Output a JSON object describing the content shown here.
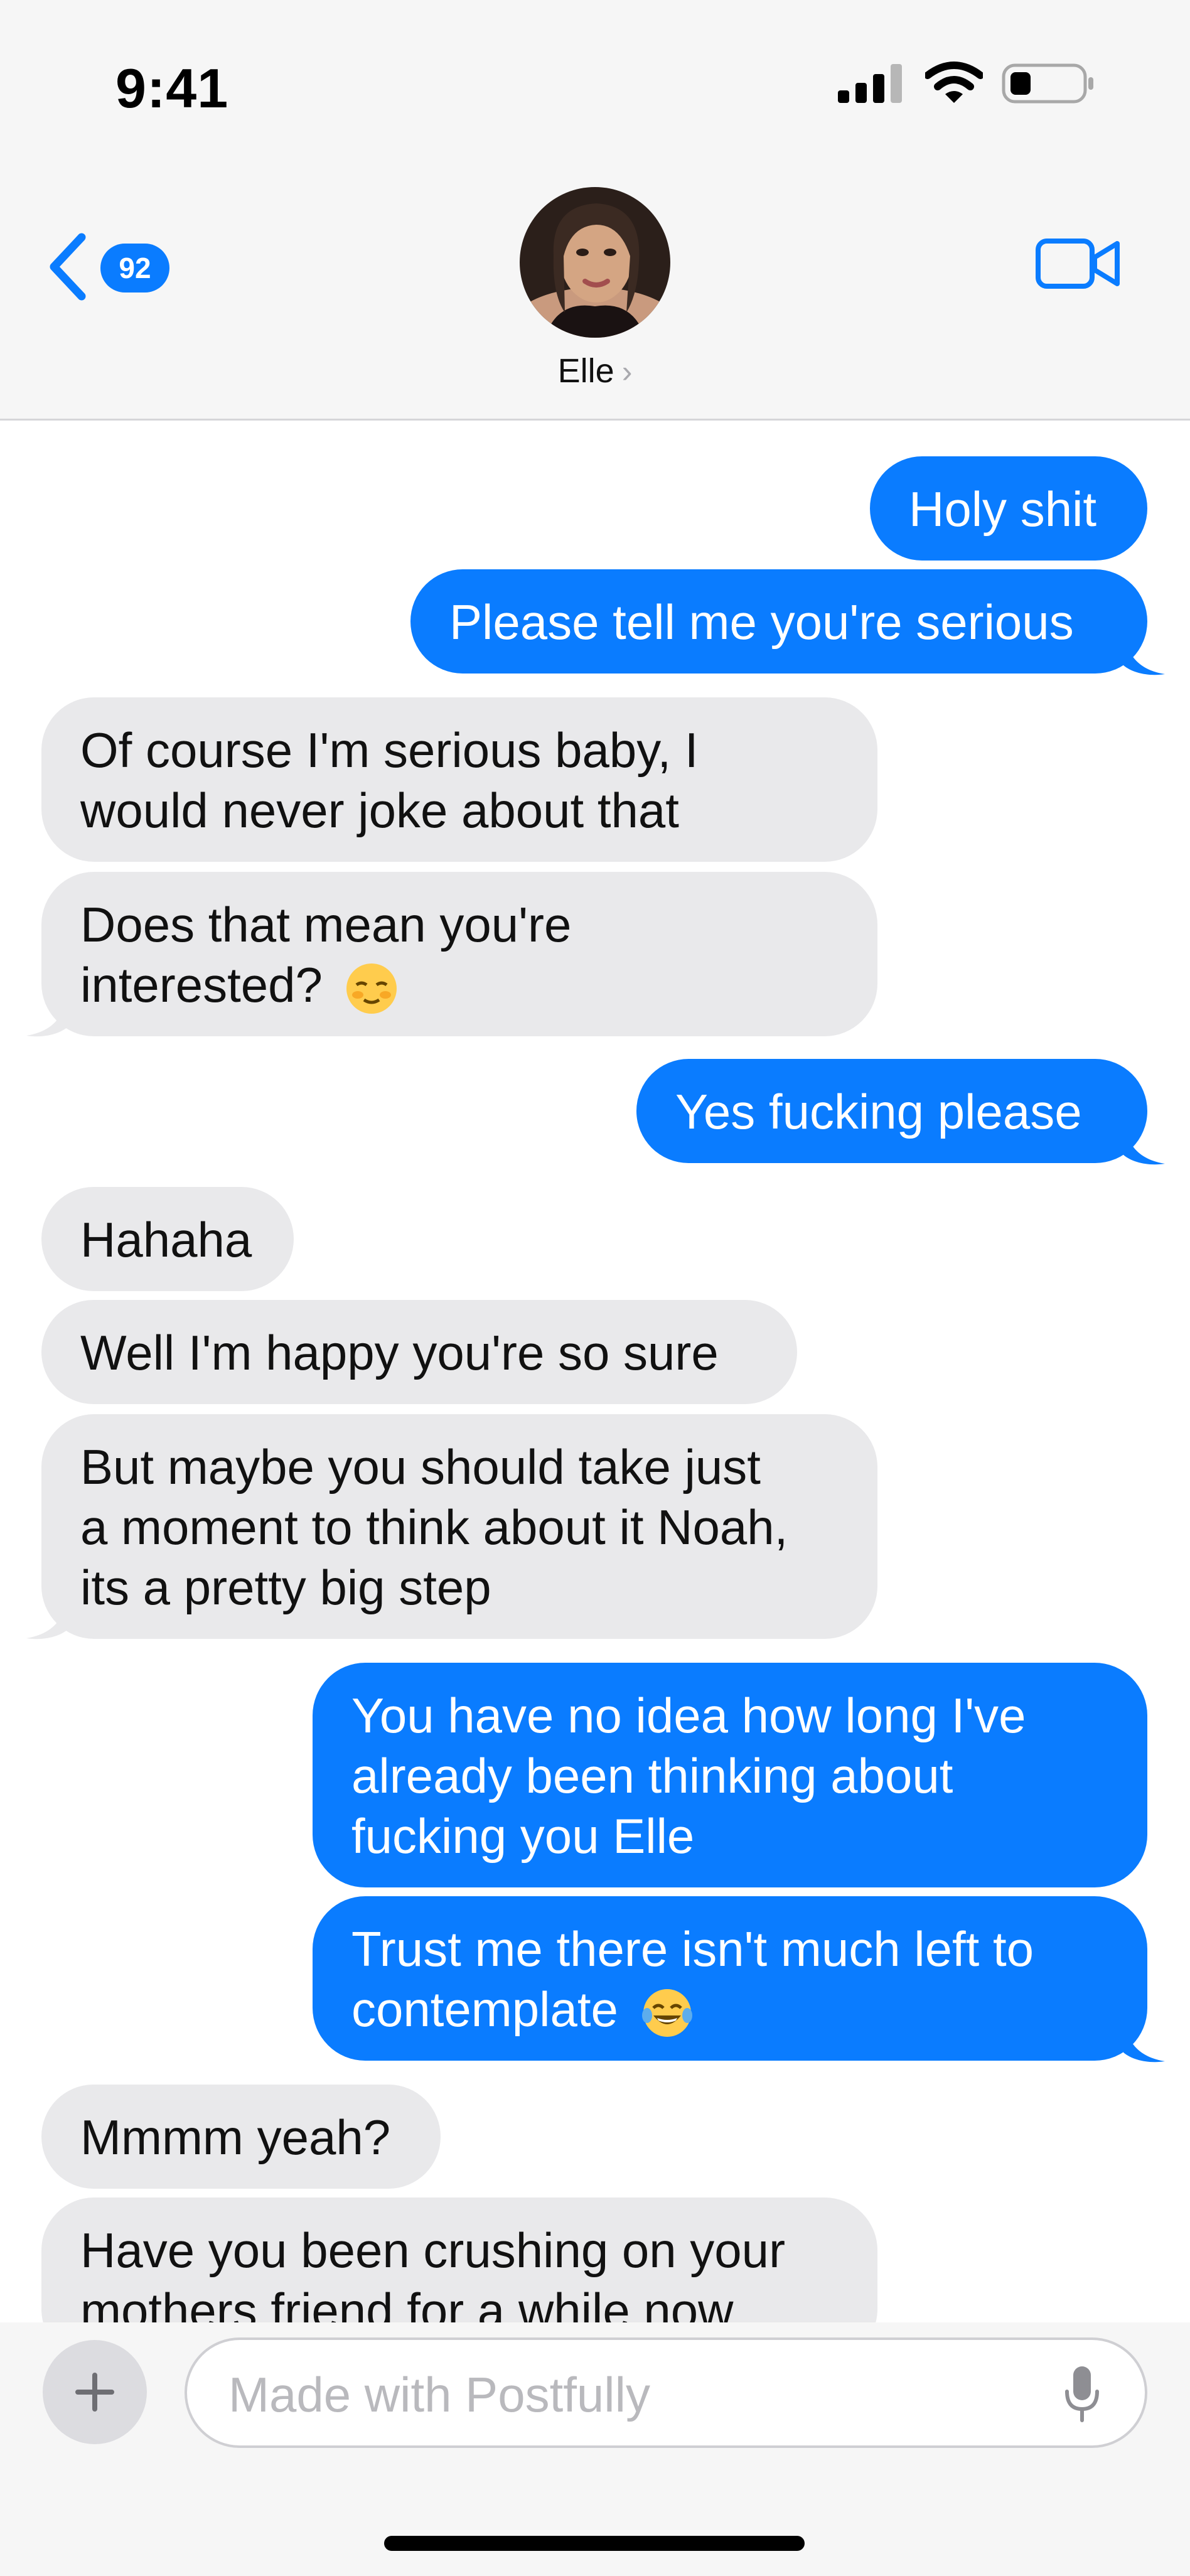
{
  "status_bar": {
    "time": "9:41"
  },
  "header": {
    "unread_count": "92",
    "contact_name": "Elle",
    "chevron": "›"
  },
  "messages": [
    {
      "from": "me",
      "lines": [
        "Holy shit"
      ]
    },
    {
      "from": "me",
      "lines": [
        "Please tell me you're serious"
      ]
    },
    {
      "from": "them",
      "lines": [
        "Of course I'm serious baby, I",
        "would never joke about that"
      ]
    },
    {
      "from": "them",
      "lines": [
        "Does that mean you're",
        "interested?"
      ],
      "emoji": "relieved-face-icon"
    },
    {
      "from": "me",
      "lines": [
        "Yes fucking please"
      ]
    },
    {
      "from": "them",
      "lines": [
        "Hahaha"
      ]
    },
    {
      "from": "them",
      "lines": [
        "Well I'm happy you're so sure"
      ]
    },
    {
      "from": "them",
      "lines": [
        "But maybe you should take just",
        "a moment to think about it Noah,",
        "its a pretty big step"
      ]
    },
    {
      "from": "me",
      "lines": [
        "You have no idea how long I've",
        "already been thinking about",
        "fucking you Elle"
      ]
    },
    {
      "from": "me",
      "lines": [
        "Trust me there isn't much left to",
        "contemplate"
      ],
      "emoji": "tears-of-joy-icon"
    },
    {
      "from": "them",
      "lines": [
        "Mmmm yeah?"
      ]
    },
    {
      "from": "them",
      "lines": [
        "Have you been crushing on your",
        "mothers friend for a while now"
      ]
    }
  ],
  "composer": {
    "placeholder": "Made with Postfully",
    "plus_label": "+"
  },
  "colors": {
    "outgoing_bubble": "#0a7cff",
    "incoming_bubble": "#e9e9eb",
    "accent": "#0a7cff"
  },
  "icons": [
    "signal-icon",
    "wifi-icon",
    "battery-icon",
    "back-chevron-icon",
    "video-call-icon",
    "microphone-icon",
    "plus-icon"
  ]
}
